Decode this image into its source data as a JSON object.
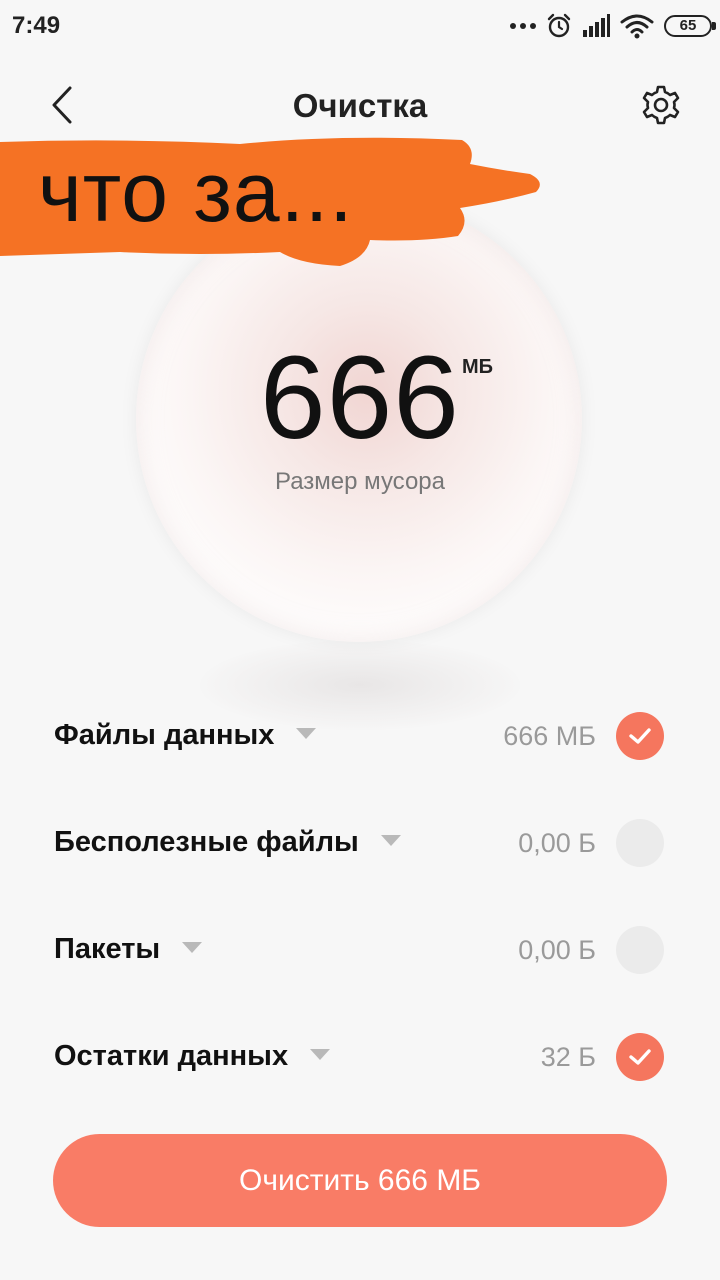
{
  "status_bar": {
    "time": "7:49",
    "battery": "65",
    "icons": [
      "more-dots-icon",
      "alarm-icon",
      "signal-icon",
      "wifi-icon",
      "battery-icon"
    ]
  },
  "header": {
    "title": "Очистка",
    "back_icon": "chevron-left-icon",
    "settings_icon": "gear-icon"
  },
  "summary": {
    "value": "666",
    "unit": "МБ",
    "caption": "Размер мусора"
  },
  "annotation": {
    "text": "что за...",
    "color": "#f57224"
  },
  "categories": [
    {
      "label": "Файлы данных",
      "size": "666 МБ",
      "checked": true
    },
    {
      "label": "Бесполезные файлы",
      "size": "0,00 Б",
      "checked": false
    },
    {
      "label": "Пакеты",
      "size": "0,00 Б",
      "checked": false
    },
    {
      "label": "Остатки данных",
      "size": "32 Б",
      "checked": true
    }
  ],
  "action": {
    "label": "Очистить 666 МБ"
  },
  "colors": {
    "accent": "#f5765e",
    "button": "#f97c66",
    "unchecked": "#ebebeb"
  }
}
